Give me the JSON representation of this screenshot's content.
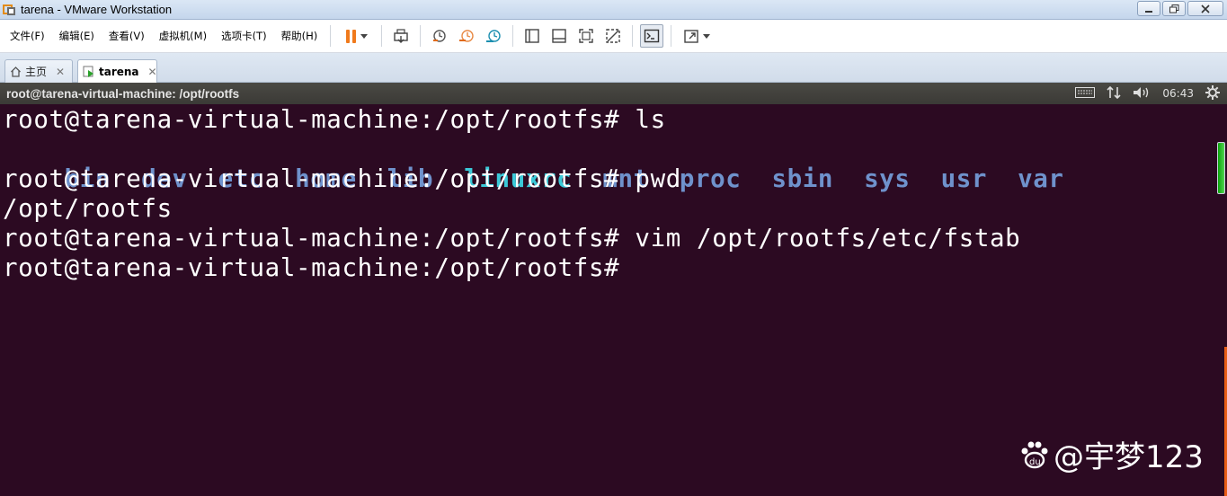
{
  "window": {
    "title": "tarena - VMware Workstation",
    "controls": [
      "minimize",
      "maximize",
      "close"
    ]
  },
  "menu": {
    "items": [
      "文件(F)",
      "编辑(E)",
      "查看(V)",
      "虚拟机(M)",
      "选项卡(T)",
      "帮助(H)"
    ]
  },
  "toolbar": {
    "icons": [
      "pause-icon",
      "send-ctrl-alt-del-icon",
      "snapshot-icon",
      "revert-snapshot-icon",
      "snapshot-manager-icon",
      "sidebar-icon",
      "thumbnail-icon",
      "fullscreen-icon",
      "unity-icon",
      "console-icon",
      "stretch-icon"
    ]
  },
  "tabs": [
    {
      "label": "主页",
      "active": false
    },
    {
      "label": "tarena",
      "active": true
    }
  ],
  "guest_panel": {
    "title": "root@tarena-virtual-machine: /opt/rootfs",
    "time": "06:43"
  },
  "terminal": {
    "line1": "root@tarena-virtual-machine:/opt/rootfs# ls",
    "ls_output": [
      {
        "name": "bin",
        "type": "dir"
      },
      {
        "name": "dev",
        "type": "dir"
      },
      {
        "name": "etc",
        "type": "dir"
      },
      {
        "name": "home",
        "type": "dir"
      },
      {
        "name": "lib",
        "type": "dir"
      },
      {
        "name": "linuxrc",
        "type": "exec"
      },
      {
        "name": "mnt",
        "type": "dir"
      },
      {
        "name": "proc",
        "type": "dir"
      },
      {
        "name": "sbin",
        "type": "dir"
      },
      {
        "name": "sys",
        "type": "dir"
      },
      {
        "name": "usr",
        "type": "dir"
      },
      {
        "name": "var",
        "type": "dir"
      }
    ],
    "line3": "root@tarena-virtual-machine:/opt/rootfs# pwd",
    "line4": "/opt/rootfs",
    "line5": "root@tarena-virtual-machine:/opt/rootfs# vim /opt/rootfs/etc/fstab",
    "line6": "root@tarena-virtual-machine:/opt/rootfs#"
  },
  "watermark": {
    "text": "@宇梦123"
  },
  "colors": {
    "terminal_bg": "#2c0a22",
    "dir": "#6f92cc",
    "exec": "#3bc9d8",
    "accent": "#f07a1c"
  }
}
